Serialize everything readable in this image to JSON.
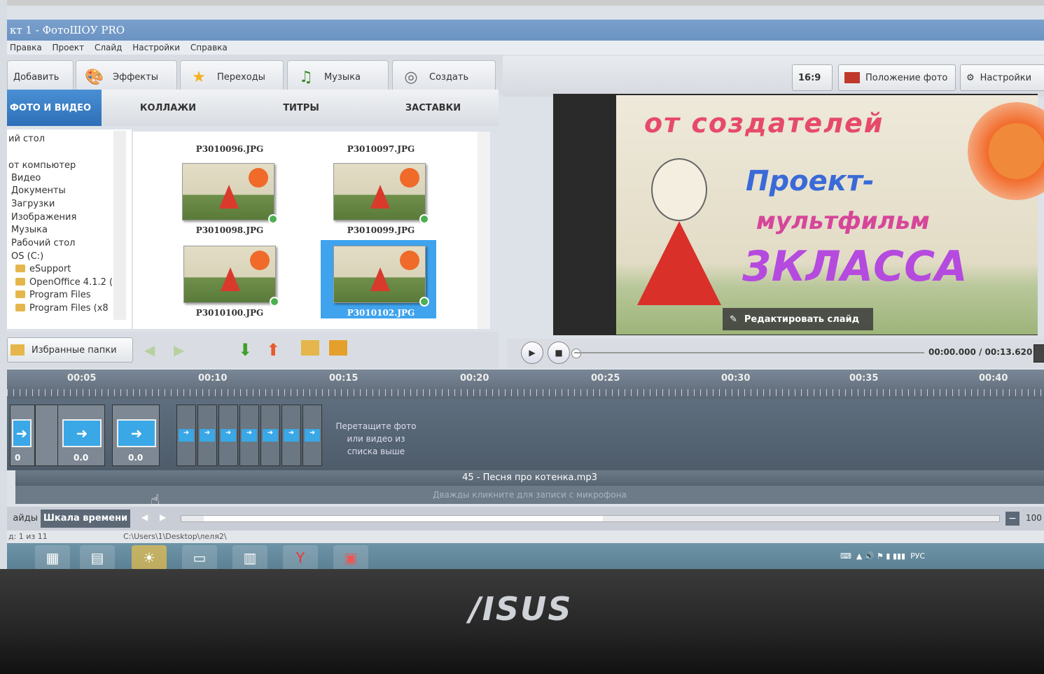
{
  "window": {
    "title": "кт 1 - ФотоШОУ PRO"
  },
  "menu": [
    "Правка",
    "Проект",
    "Слайд",
    "Настройки",
    "Справка"
  ],
  "toolbar": [
    {
      "label": "Добавить",
      "icon": "add-icon"
    },
    {
      "label": "Эффекты",
      "icon": "palette-icon"
    },
    {
      "label": "Переходы",
      "icon": "star-icon"
    },
    {
      "label": "Музыка",
      "icon": "music-icon"
    },
    {
      "label": "Создать",
      "icon": "disc-icon"
    }
  ],
  "right_toolbar": {
    "aspect": "16:9",
    "photo_position": "Положение фото",
    "settings": "Настройки"
  },
  "tabs": [
    "ФОТО И ВИДЕО",
    "КОЛЛАЖИ",
    "ТИТРЫ",
    "ЗАСТАВКИ"
  ],
  "tree": [
    "ий стол",
    "от компьютер",
    "Видео",
    "Документы",
    "Загрузки",
    "Изображения",
    "Музыка",
    "Рабочий стол",
    "OS (C:)",
    "eSupport",
    "OpenOffice 4.1.2 (",
    "Program Files",
    "Program Files (x8"
  ],
  "gallery": [
    {
      "name": "P3010096.JPG"
    },
    {
      "name": "P3010097.JPG"
    },
    {
      "name": "P3010098.JPG"
    },
    {
      "name": "P3010099.JPG"
    },
    {
      "name": "P3010100.JPG"
    },
    {
      "name": "P3010102.JPG",
      "selected": true
    }
  ],
  "favorites": "Избранные папки",
  "slide": {
    "line1": "от создателей",
    "line2": "Проект-",
    "line3": "мультфильм",
    "line4": "3КЛАССА"
  },
  "edit_slide": "Редактировать слайд",
  "player": {
    "time": "00:00.000 / 00:13.620"
  },
  "ruler": [
    "00:05",
    "00:10",
    "00:15",
    "00:20",
    "00:25",
    "00:30",
    "00:35",
    "00:40"
  ],
  "timeline": {
    "clips": [
      "0",
      "0.0",
      "0.0"
    ],
    "drop_hint": "Перетащите фото или видео из списка выше",
    "music": "45 - Песня про котенка.mp3",
    "mic": "Дважды кликните для записи с микрофона"
  },
  "bottom": {
    "slides_tab": "айды",
    "timeline_tab": "Шкала времени",
    "zoom": "100"
  },
  "status": {
    "left": "д: 1 из 11",
    "path": "C:\\Users\\1\\Desktop\\леля2\\"
  },
  "tray": "РУС",
  "brand": "/ISUS",
  "colors": {
    "selection": "#3fa3ee",
    "tab_active": "#2d6fb8",
    "timeline": "#5c6876"
  }
}
